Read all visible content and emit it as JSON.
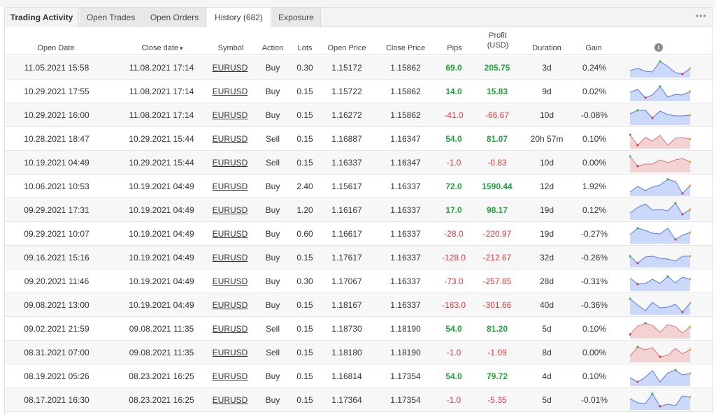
{
  "tabs": {
    "title": "Trading Activity",
    "items": [
      "Open Trades",
      "Open Orders",
      "History (682)",
      "Exposure"
    ],
    "more": "•••"
  },
  "columns": {
    "open_date": "Open Date",
    "close_date": "Close date",
    "sort_arrow": "▾",
    "symbol": "Symbol",
    "action": "Action",
    "lots": "Lots",
    "open_price": "Open Price",
    "close_price": "Close Price",
    "pips": "Pips",
    "profit": "Profit",
    "profit_unit": "(USD)",
    "duration": "Duration",
    "gain": "Gain",
    "info": "i"
  },
  "colors": {
    "positive": "#20a33a",
    "negative": "#e0393b",
    "buy_fill": "#c9d8fb",
    "buy_line": "#5b79e8",
    "sell_fill": "#f2d2d2",
    "sell_line": "#d9777b"
  },
  "trades": [
    {
      "open": "11.05.2021 15:58",
      "close": "11.08.2021 17:14",
      "symbol": "EURUSD",
      "action": "Buy",
      "lots": "0.30",
      "open_price": "1.15172",
      "close_price": "1.15862",
      "pips": "69.0",
      "profit": "205.75",
      "duration": "3d",
      "gain": "0.24%"
    },
    {
      "open": "10.29.2021 17:55",
      "close": "11.08.2021 17:14",
      "symbol": "EURUSD",
      "action": "Buy",
      "lots": "0.15",
      "open_price": "1.15722",
      "close_price": "1.15862",
      "pips": "14.0",
      "profit": "15.83",
      "duration": "9d",
      "gain": "0.02%"
    },
    {
      "open": "10.29.2021 16:00",
      "close": "11.08.2021 17:14",
      "symbol": "EURUSD",
      "action": "Buy",
      "lots": "0.15",
      "open_price": "1.16272",
      "close_price": "1.15862",
      "pips": "-41.0",
      "profit": "-66.67",
      "duration": "10d",
      "gain": "-0.08%"
    },
    {
      "open": "10.28.2021 18:47",
      "close": "10.29.2021 15:44",
      "symbol": "EURUSD",
      "action": "Sell",
      "lots": "0.15",
      "open_price": "1.16887",
      "close_price": "1.16347",
      "pips": "54.0",
      "profit": "81.07",
      "duration": "20h 57m",
      "gain": "0.10%"
    },
    {
      "open": "10.19.2021 04:49",
      "close": "10.29.2021 15:44",
      "symbol": "EURUSD",
      "action": "Sell",
      "lots": "0.15",
      "open_price": "1.16337",
      "close_price": "1.16347",
      "pips": "-1.0",
      "profit": "-0.83",
      "duration": "10d",
      "gain": "0.00%"
    },
    {
      "open": "10.06.2021 10:53",
      "close": "10.19.2021 04:49",
      "symbol": "EURUSD",
      "action": "Buy",
      "lots": "2.40",
      "open_price": "1.15617",
      "close_price": "1.16337",
      "pips": "72.0",
      "profit": "1590.44",
      "duration": "12d",
      "gain": "1.92%"
    },
    {
      "open": "09.29.2021 17:31",
      "close": "10.19.2021 04:49",
      "symbol": "EURUSD",
      "action": "Buy",
      "lots": "1.20",
      "open_price": "1.16167",
      "close_price": "1.16337",
      "pips": "17.0",
      "profit": "98.17",
      "duration": "19d",
      "gain": "0.12%"
    },
    {
      "open": "09.29.2021 10:07",
      "close": "10.19.2021 04:49",
      "symbol": "EURUSD",
      "action": "Buy",
      "lots": "0.60",
      "open_price": "1.16617",
      "close_price": "1.16337",
      "pips": "-28.0",
      "profit": "-220.97",
      "duration": "19d",
      "gain": "-0.27%"
    },
    {
      "open": "09.16.2021 15:16",
      "close": "10.19.2021 04:49",
      "symbol": "EURUSD",
      "action": "Buy",
      "lots": "0.15",
      "open_price": "1.17617",
      "close_price": "1.16337",
      "pips": "-128.0",
      "profit": "-212.67",
      "duration": "32d",
      "gain": "-0.26%"
    },
    {
      "open": "09.20.2021 11:46",
      "close": "10.19.2021 04:49",
      "symbol": "EURUSD",
      "action": "Buy",
      "lots": "0.30",
      "open_price": "1.17067",
      "close_price": "1.16337",
      "pips": "-73.0",
      "profit": "-257.85",
      "duration": "28d",
      "gain": "-0.31%"
    },
    {
      "open": "09.08.2021 13:00",
      "close": "10.19.2021 04:49",
      "symbol": "EURUSD",
      "action": "Buy",
      "lots": "0.15",
      "open_price": "1.18167",
      "close_price": "1.16337",
      "pips": "-183.0",
      "profit": "-301.66",
      "duration": "40d",
      "gain": "-0.36%"
    },
    {
      "open": "09.02.2021 21:59",
      "close": "09.08.2021 11:35",
      "symbol": "EURUSD",
      "action": "Sell",
      "lots": "0.15",
      "open_price": "1.18730",
      "close_price": "1.18190",
      "pips": "54.0",
      "profit": "81.20",
      "duration": "5d",
      "gain": "0.10%"
    },
    {
      "open": "08.31.2021 07:00",
      "close": "09.08.2021 11:35",
      "symbol": "EURUSD",
      "action": "Sell",
      "lots": "0.15",
      "open_price": "1.18180",
      "close_price": "1.18190",
      "pips": "-1.0",
      "profit": "-1.09",
      "duration": "8d",
      "gain": "0.00%"
    },
    {
      "open": "08.19.2021 05:26",
      "close": "08.23.2021 16:25",
      "symbol": "EURUSD",
      "action": "Buy",
      "lots": "0.15",
      "open_price": "1.16814",
      "close_price": "1.17354",
      "pips": "54.0",
      "profit": "79.72",
      "duration": "4d",
      "gain": "0.10%"
    },
    {
      "open": "08.17.2021 16:30",
      "close": "08.23.2021 16:25",
      "symbol": "EURUSD",
      "action": "Buy",
      "lots": "0.15",
      "open_price": "1.17364",
      "close_price": "1.17354",
      "pips": "-1.0",
      "profit": "-5.35",
      "duration": "5d",
      "gain": "-0.01%"
    }
  ]
}
